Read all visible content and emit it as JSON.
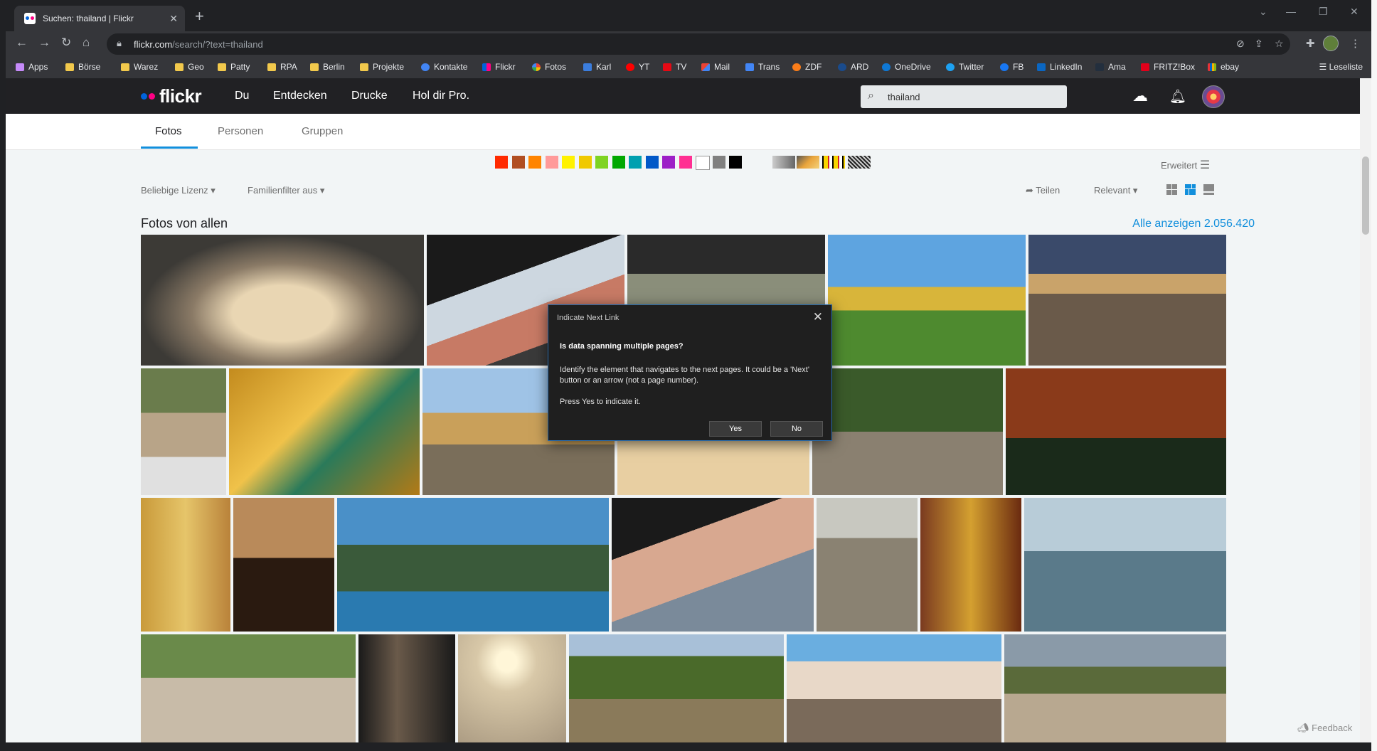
{
  "browser": {
    "tab_title": "Suchen: thailand | Flickr",
    "tab_close": "✕",
    "new_tab": "+",
    "url_domain": "flickr.com",
    "url_path": "/search/?text=thailand",
    "bookmarks": [
      "Apps",
      "Börse",
      "Warez",
      "Geo",
      "Patty",
      "RPA",
      "Berlin",
      "Projekte",
      "Kontakte",
      "Flickr",
      "Fotos",
      "Karl",
      "YT",
      "TV",
      "Mail",
      "Trans",
      "ZDF",
      "ARD",
      "OneDrive",
      "Twitter",
      "FB",
      "LinkedIn",
      "Ama",
      "FRITZ!Box",
      "ebay"
    ],
    "reading_list": "Leseliste"
  },
  "flickr": {
    "logo": "flickr",
    "nav": [
      "Du",
      "Entdecken",
      "Drucke",
      "Hol dir Pro."
    ],
    "search_value": "thailand",
    "tabs": [
      "Fotos",
      "Personen",
      "Gruppen"
    ],
    "advanced": "Erweitert",
    "filters": {
      "license": "Beliebige Lizenz",
      "family": "Familienfilter aus",
      "share": "Teilen",
      "sort": "Relevant"
    },
    "section_title": "Fotos von allen",
    "see_all": "Alle anzeigen 2.056.420",
    "feedback": "Feedback",
    "swatch_colors": [
      "#ff2a00",
      "#b14e21",
      "#ff8400",
      "#ff9a9a",
      "#fff200",
      "#f0c900",
      "#7ed321",
      "#00a800",
      "#00a0b0",
      "#0058c8",
      "#9d1fc7",
      "#ff2f92",
      "#ffffff",
      "#808080",
      "#000000"
    ]
  },
  "dialog": {
    "title": "Indicate Next Link",
    "close": "✕",
    "heading": "Is data spanning multiple pages?",
    "body": "Identify the element that navigates to the next pages. It could be a 'Next' button or an arrow (not a page number).",
    "press": "Press Yes to indicate it.",
    "yes": "Yes",
    "no": "No"
  }
}
